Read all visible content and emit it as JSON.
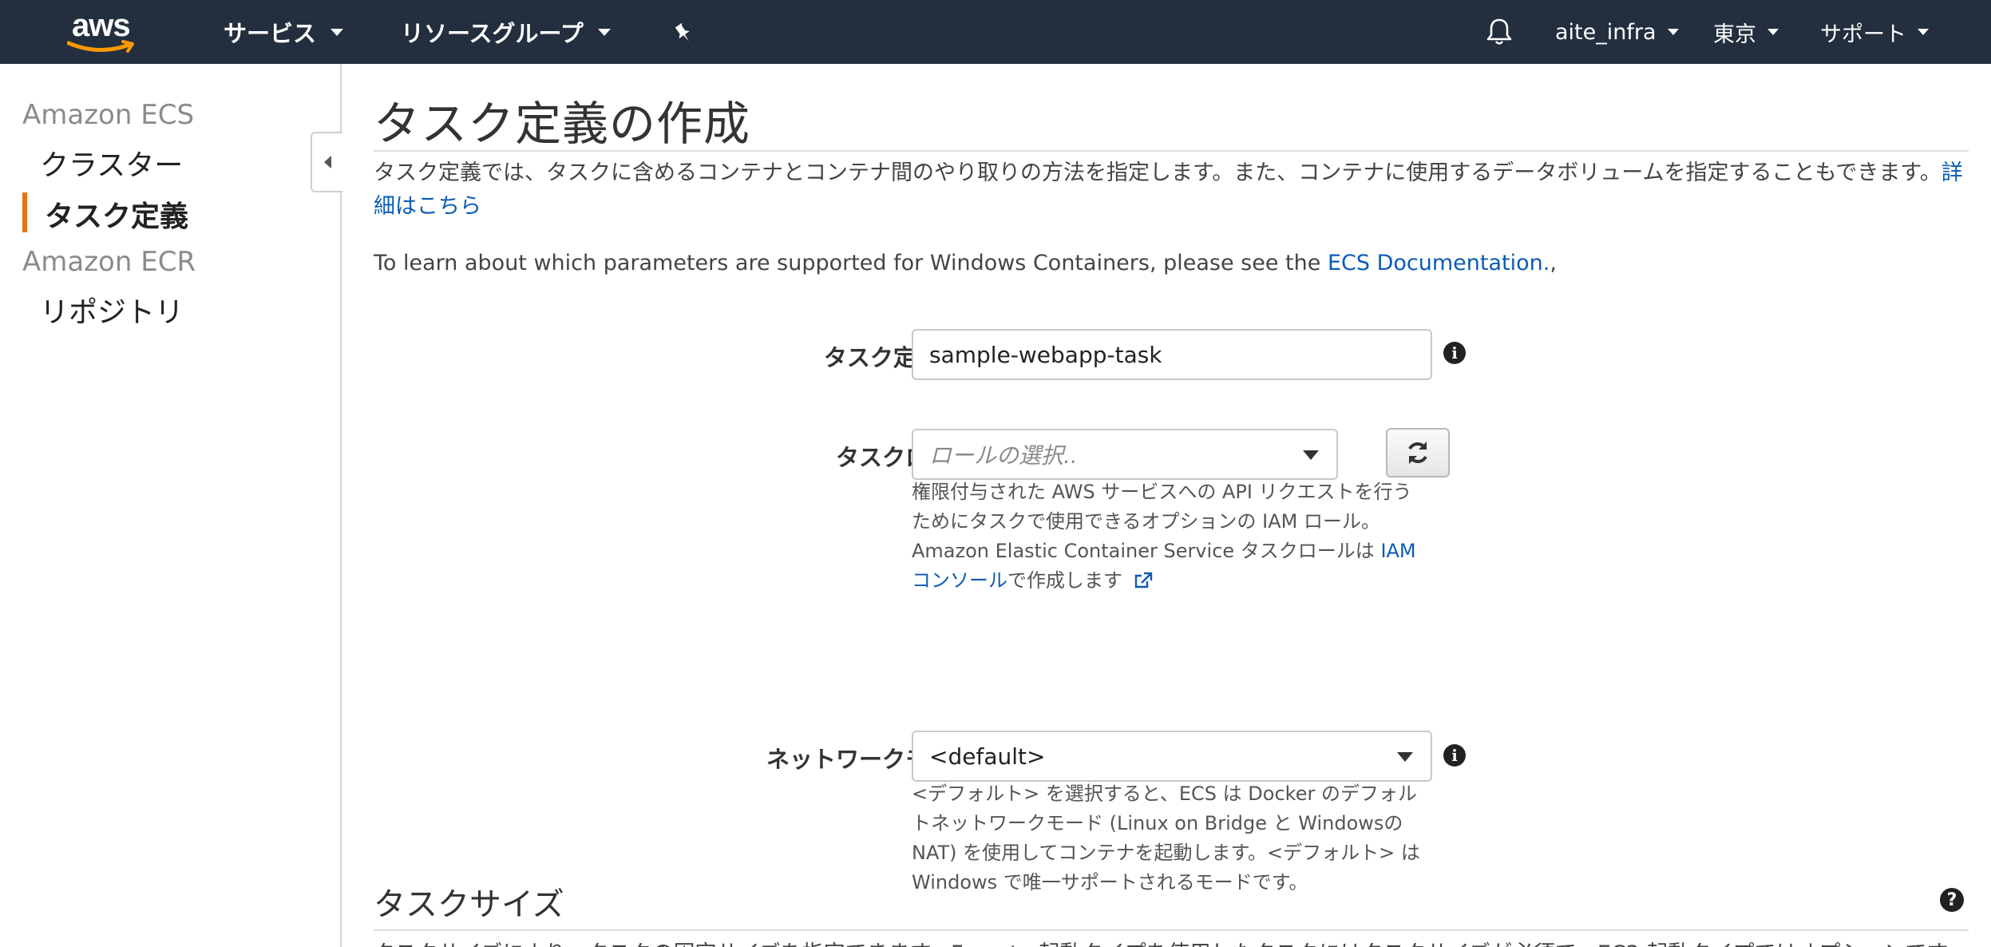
{
  "topnav": {
    "logo_text": "aws",
    "services_label": "サービス",
    "resource_groups_label": "リソースグループ",
    "user_label": "aite_infra",
    "region_label": "東京",
    "support_label": "サポート",
    "icons": [
      "aws-logo",
      "pin-icon",
      "bell-icon"
    ]
  },
  "sidebar": {
    "ecs_heading": "Amazon ECS",
    "items_ecs": [
      {
        "label": "クラスター",
        "active": false
      },
      {
        "label": "タスク定義",
        "active": true
      }
    ],
    "ecr_heading": "Amazon ECR",
    "items_ecr": [
      {
        "label": "リポジトリ",
        "active": false
      }
    ],
    "active_color": "#ec7211"
  },
  "main": {
    "title": "タスク定義の作成",
    "description": "タスク定義では、タスクに含めるコンテナとコンテナ間のやり取りの方法を指定します。また、コンテナに使用するデータボリュームを指定することもできます。",
    "description_link": "詳細はこちら",
    "windows_note": "To learn about which parameters are supported for Windows Containers, please see the ",
    "windows_note_link": "ECS Documentation.",
    "windows_note_tail": ","
  },
  "form": {
    "task_def_name": {
      "label": "タスク定義名*",
      "value": "sample-webapp-task"
    },
    "task_role": {
      "label": "タスクロール",
      "placeholder": "ロールの選択..",
      "help_1": "権限付与された AWS サービスへの API リクエストを行うためにタスクで使用できるオプションの IAM ロール。Amazon Elastic Container Service タスクロールは ",
      "help_link": "IAM コンソール",
      "help_2": "で作成します"
    },
    "network_mode": {
      "label": "ネットワークモード",
      "value": "<default>",
      "help": "<デフォルト> を選択すると、ECS は Docker のデフォルトネットワークモード (Linux on Bridge と Windowsの NAT) を使用してコンテナを起動します。<デフォルト> は Windows で唯一サポートされるモードです。"
    }
  },
  "task_size": {
    "title": "タスクサイズ",
    "cut_text": "タスクサイズにより、タスクの固定サイズを指定できます。Fargate 起動タイプを使用したタスクにはタスクサイズが必須で、EC2 起動タイプではオプションです。"
  },
  "colors": {
    "nav_bg": "#232f3e",
    "link": "#0b5bb5",
    "accent": "#ec7211"
  }
}
